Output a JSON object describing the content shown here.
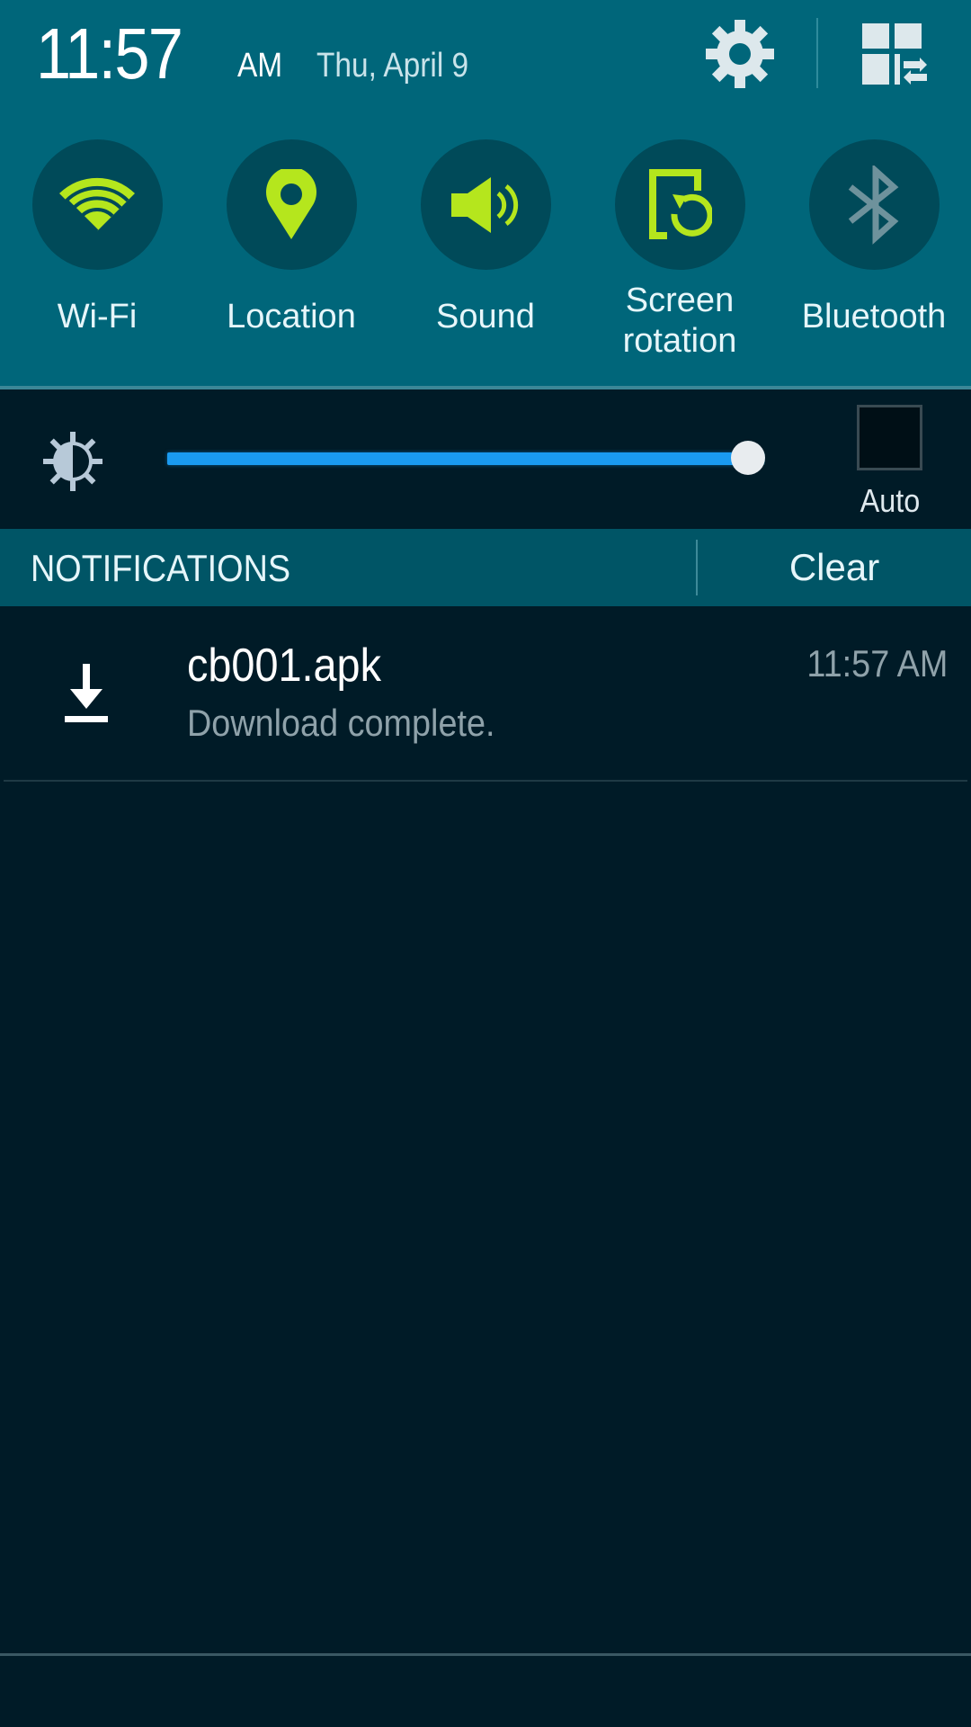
{
  "header": {
    "time": "11:57",
    "ampm": "AM",
    "date": "Thu, April 9",
    "settings_icon": "gear-icon",
    "edit_icon": "quick-settings-edit-icon"
  },
  "quick_toggles": [
    {
      "label": "Wi-Fi",
      "icon": "wifi-icon",
      "state": "on"
    },
    {
      "label": "Location",
      "icon": "location-pin-icon",
      "state": "on"
    },
    {
      "label": "Sound",
      "icon": "speaker-icon",
      "state": "on"
    },
    {
      "label": "Screen\nrotation",
      "icon": "screen-rotation-icon",
      "state": "on"
    },
    {
      "label": "Bluetooth",
      "icon": "bluetooth-icon",
      "state": "off"
    }
  ],
  "brightness": {
    "icon": "brightness-icon",
    "level_percent": 100,
    "auto_label": "Auto",
    "auto_checked": false
  },
  "notifications": {
    "title": "NOTIFICATIONS",
    "clear_label": "Clear",
    "items": [
      {
        "icon": "download-icon",
        "title": "cb001.apk",
        "text": "Download complete.",
        "time": "11:57 AM"
      }
    ]
  },
  "colors": {
    "header_bg": "#00667a",
    "toggle_on": "#b5e61d",
    "toggle_off": "#6e929c",
    "slider_fill": "#1a9af0",
    "panel_bg": "#001b27"
  }
}
